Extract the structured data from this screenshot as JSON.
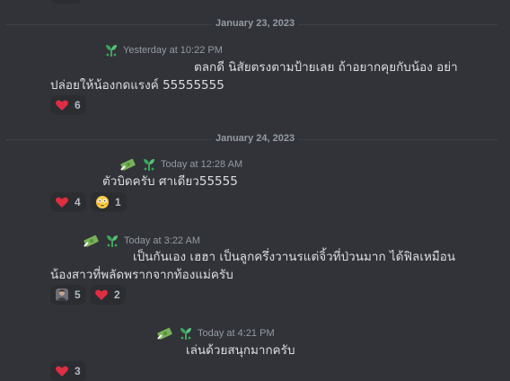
{
  "dividers": [
    {
      "label": "January 23, 2023"
    },
    {
      "label": "January 24, 2023"
    }
  ],
  "messages": [
    {
      "timestamp": "Yesterday at 10:22 PM",
      "lines": [
        "ตลกดี นิสัยตรงตามป้ายเลย ถ้าอยากคุยกับน้อง อย่า",
        "ปล่อยให้น้องกดแรงค์ 55555555"
      ],
      "reactions": [
        {
          "emoji": "heart-icon",
          "count": "6"
        }
      ]
    },
    {
      "timestamp": "Today at 12:28 AM",
      "lines": [
        "ตัวบิดครับ ศาเดียว55555"
      ],
      "reactions": [
        {
          "emoji": "heart-icon",
          "count": "4"
        },
        {
          "emoji": "flushed-face-icon",
          "count": "1"
        }
      ]
    },
    {
      "timestamp": "Today at 3:22 AM",
      "lines": [
        "เป็นกันเอง เฮฮา เป็นลูกครึ่งวานรแต่จิ้วที่ป่วนมาก ได้ฟิลเหมือน",
        "น้องสาวที่พลัดพรากจากท้องแม่ครับ"
      ],
      "reactions": [
        {
          "emoji": "avatar-emoji-icon",
          "count": "5"
        },
        {
          "emoji": "heart-icon",
          "count": "2"
        }
      ]
    },
    {
      "timestamp": "Today at 4:21 PM",
      "lines": [
        "เล่นด้วยสนุกมากครับ"
      ],
      "reactions": [
        {
          "emoji": "heart-icon",
          "count": "3"
        }
      ]
    }
  ],
  "colors": {
    "background": "#313338",
    "reaction_bg": "#2b2d31",
    "heart": "#dd2e44",
    "sprout": "#3ba55d",
    "muted_text": "#949ba4",
    "body_text": "#dbdee1"
  }
}
